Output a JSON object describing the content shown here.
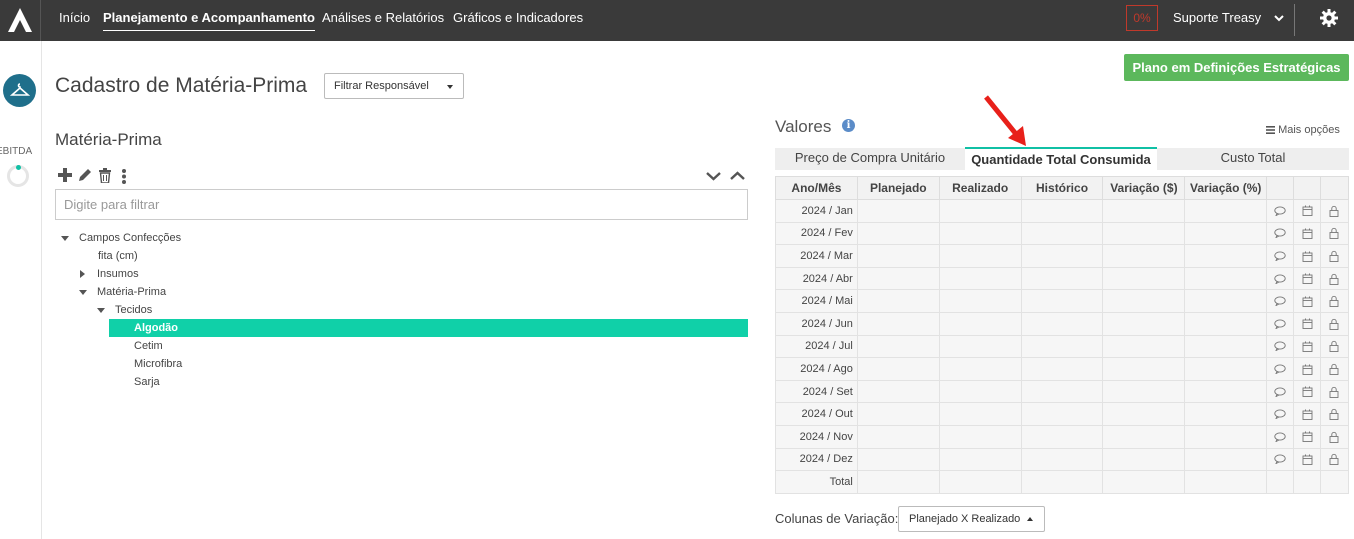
{
  "nav": {
    "items": [
      "Início",
      "Planejamento e Acompanhamento",
      "Análises e Relatórios",
      "Gráficos e Indicadores"
    ],
    "active_index": 1,
    "progress_badge": "0%",
    "user": "Suporte Treasy"
  },
  "rail": {
    "label": "EBITDA"
  },
  "header": {
    "title": "Cadastro de Matéria-Prima",
    "filter_label": "Filtrar Responsável",
    "plan_button": "Plano em Definições Estratégicas"
  },
  "left": {
    "section_title": "Matéria-Prima",
    "filter_placeholder": "Digite para filtrar",
    "tree": {
      "root": "Campos Confecções",
      "fita": "fita (cm)",
      "insumos": "Insumos",
      "materia": "Matéria-Prima",
      "tecidos": "Tecidos",
      "selected": "Algodão",
      "cetim": "Cetim",
      "microfibra": "Microfibra",
      "sarja": "Sarja"
    }
  },
  "right": {
    "title": "Valores",
    "more_options": "Mais opções",
    "tabs": [
      "Preço de Compra Unitário",
      "Quantidade Total Consumida",
      "Custo Total"
    ],
    "active_tab": 1,
    "columns": [
      "Ano/Mês",
      "Planejado",
      "Realizado",
      "Histórico",
      "Variação ($)",
      "Variação (%)"
    ],
    "rows": [
      "2024 / Jan",
      "2024 / Fev",
      "2024 / Mar",
      "2024 / Abr",
      "2024 / Mai",
      "2024 / Jun",
      "2024 / Jul",
      "2024 / Ago",
      "2024 / Set",
      "2024 / Out",
      "2024 / Nov",
      "2024 / Dez"
    ],
    "total_label": "Total",
    "variation_label": "Colunas de Variação:",
    "variation_value": "Planejado X Realizado"
  },
  "colors": {
    "accent": "#10c0a5",
    "topbar": "#3a3a3a",
    "plan_button": "#5cb85c",
    "badge": "#c0392b",
    "arrow": "#e8201a"
  }
}
